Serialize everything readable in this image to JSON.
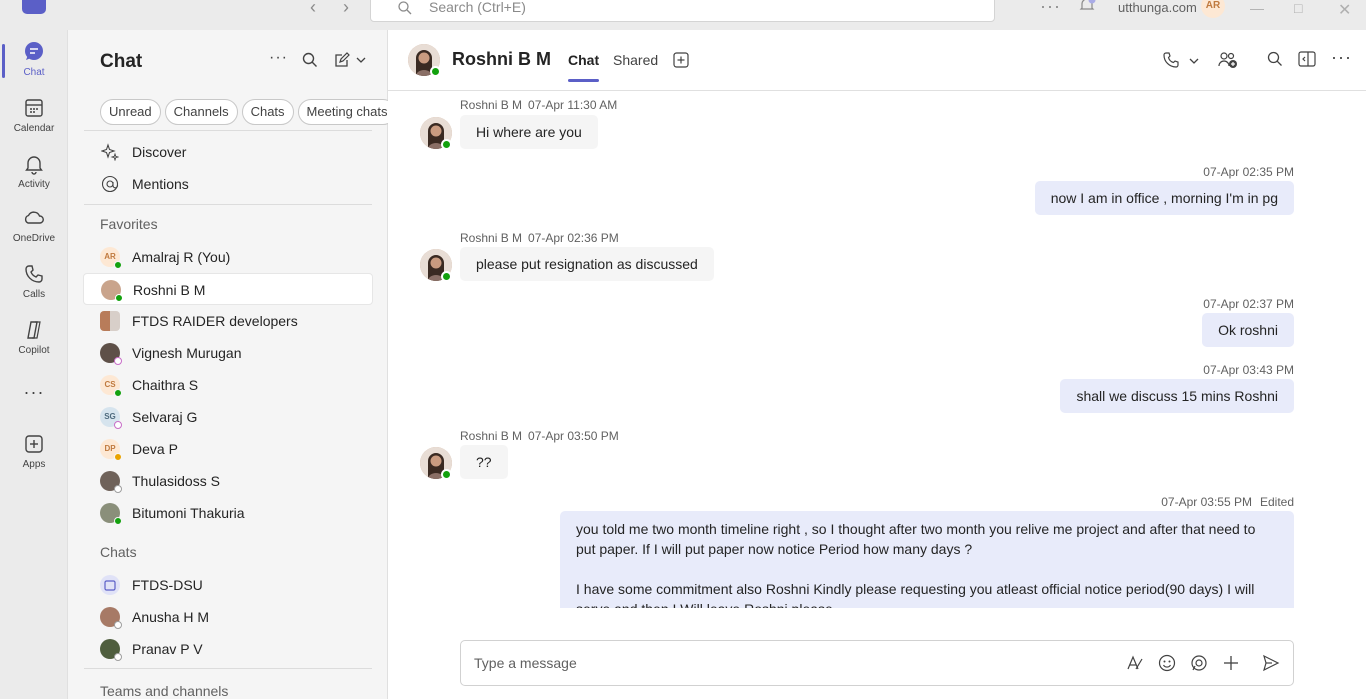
{
  "titlebar": {
    "search_placeholder": "Search (Ctrl+E)",
    "org": "utthunga.com",
    "user_initials": "AR"
  },
  "rail": [
    {
      "label": "Chat",
      "icon": "chat-icon"
    },
    {
      "label": "Calendar",
      "icon": "calendar-icon"
    },
    {
      "label": "Activity",
      "icon": "bell-icon"
    },
    {
      "label": "OneDrive",
      "icon": "cloud-icon"
    },
    {
      "label": "Calls",
      "icon": "phone-icon"
    },
    {
      "label": "Copilot",
      "icon": "copilot-icon"
    },
    {
      "label": "Apps",
      "icon": "add-app-icon"
    }
  ],
  "pane": {
    "title": "Chat",
    "filters": [
      "Unread",
      "Channels",
      "Chats",
      "Meeting chats"
    ],
    "quick": [
      {
        "label": "Discover",
        "icon": "sparkle-icon"
      },
      {
        "label": "Mentions",
        "icon": "at-icon"
      }
    ],
    "favorites_label": "Favorites",
    "favorites": [
      {
        "name": "Amalraj R (You)",
        "initials": "AR",
        "presence": "available"
      },
      {
        "name": "Roshni B M",
        "initials": "",
        "presence": "available"
      },
      {
        "name": "FTDS RAIDER developers",
        "initials": "",
        "presence": ""
      },
      {
        "name": "Vignesh Murugan",
        "initials": "",
        "presence": "offline"
      },
      {
        "name": "Chaithra S",
        "initials": "CS",
        "presence": "available"
      },
      {
        "name": "Selvaraj G",
        "initials": "SG",
        "presence": "offline"
      },
      {
        "name": "Deva P",
        "initials": "DP",
        "presence": "away"
      },
      {
        "name": "Thulasidoss S",
        "initials": "",
        "presence": "offline"
      },
      {
        "name": "Bitumoni Thakuria",
        "initials": "",
        "presence": "available"
      }
    ],
    "chats_label": "Chats",
    "chats": [
      {
        "name": "FTDS-DSU",
        "initials": "",
        "presence": ""
      },
      {
        "name": "Anusha H M",
        "initials": "",
        "presence": "offline"
      },
      {
        "name": "Pranav P V",
        "initials": "",
        "presence": "offline"
      }
    ],
    "teams_label": "Teams and channels"
  },
  "header": {
    "name": "Roshni B M",
    "tabs": [
      "Chat",
      "Shared"
    ]
  },
  "messages": [
    {
      "dir": "in",
      "sender": "Roshni B M",
      "time": "07-Apr 11:30 AM",
      "text": "Hi where are you"
    },
    {
      "dir": "out",
      "time": "07-Apr 02:35 PM",
      "text": "now I am in office , morning I'm in pg"
    },
    {
      "dir": "in",
      "sender": "Roshni B M",
      "time": "07-Apr 02:36 PM",
      "text": "please put resignation as discussed"
    },
    {
      "dir": "out",
      "time": "07-Apr 02:37 PM",
      "text": "Ok roshni"
    },
    {
      "dir": "out",
      "time": "07-Apr 03:43 PM",
      "text": "shall we discuss 15 mins Roshni"
    },
    {
      "dir": "in",
      "sender": "Roshni B M",
      "time": "07-Apr 03:50 PM",
      "text": "??"
    },
    {
      "dir": "out",
      "time": "07-Apr 03:55 PM",
      "edited": "Edited",
      "line1": "you told me two month timeline right , so I thought after two month you relive me project and after that need to put paper. If I will put paper now notice Period how many days ?",
      "line2": "I have some  commitment also Roshni Kindly please requesting you atleast official notice period(90 days) I will serve and then I Will leave Roshni please"
    }
  ],
  "compose": {
    "placeholder": "Type a message"
  },
  "colors": {
    "accent": "#5b5fc7",
    "available": "#13a10e",
    "away": "#eaa300",
    "offline": "#9e9e9e",
    "outgoing_bubble": "#e8ebfa"
  }
}
